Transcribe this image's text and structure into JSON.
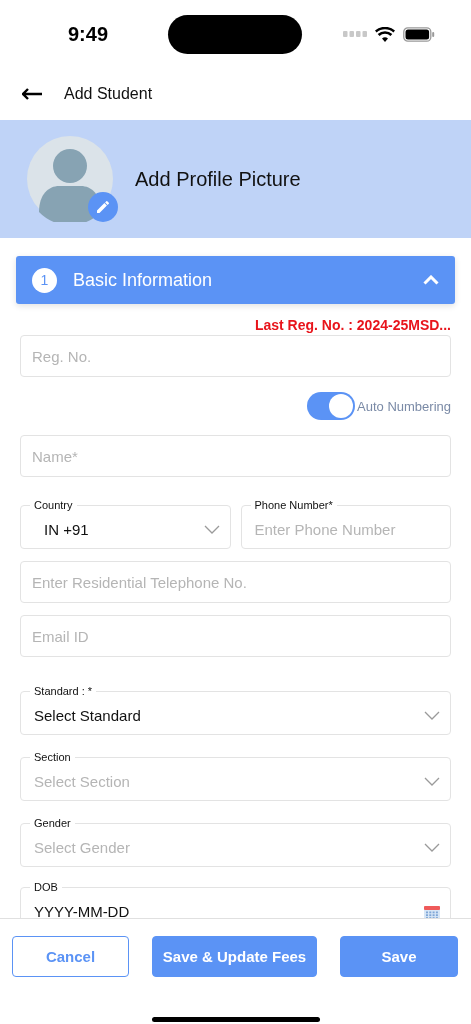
{
  "status_bar": {
    "time": "9:49"
  },
  "header": {
    "title": "Add Student"
  },
  "profile": {
    "label": "Add Profile Picture"
  },
  "section": {
    "number": "1",
    "title": "Basic Information",
    "expanded": true
  },
  "fields": [
    {
      "kind": "note",
      "text": "Last Reg. No. : 2024-25MSD..."
    },
    {
      "kind": "text",
      "placeholder": "Reg. No."
    },
    {
      "kind": "toggle",
      "label": "Auto Numbering",
      "on": true
    },
    {
      "kind": "text",
      "placeholder": "Name*"
    },
    {
      "kind": "pair",
      "items": [
        {
          "kind": "select",
          "label": "Country",
          "value": "IN +91"
        },
        {
          "kind": "text",
          "label": "Phone Number*",
          "placeholder": "Enter Phone Number"
        }
      ]
    },
    {
      "kind": "text",
      "placeholder": "Enter Residential Telephone No."
    },
    {
      "kind": "text",
      "placeholder": "Email ID"
    },
    {
      "kind": "select",
      "label": "Standard : *",
      "value": "Select Standard"
    },
    {
      "kind": "select",
      "label": "Section",
      "placeholder": "Select Section"
    },
    {
      "kind": "select",
      "label": "Gender",
      "placeholder": "Select Gender"
    },
    {
      "kind": "date",
      "label": "DOB",
      "value": "YYYY-MM-DD"
    }
  ],
  "buttons": [
    {
      "label": "Cancel",
      "kind": "outline"
    },
    {
      "label": "Save & Update Fees",
      "kind": "filled"
    },
    {
      "label": "Save",
      "kind": "filled"
    }
  ]
}
